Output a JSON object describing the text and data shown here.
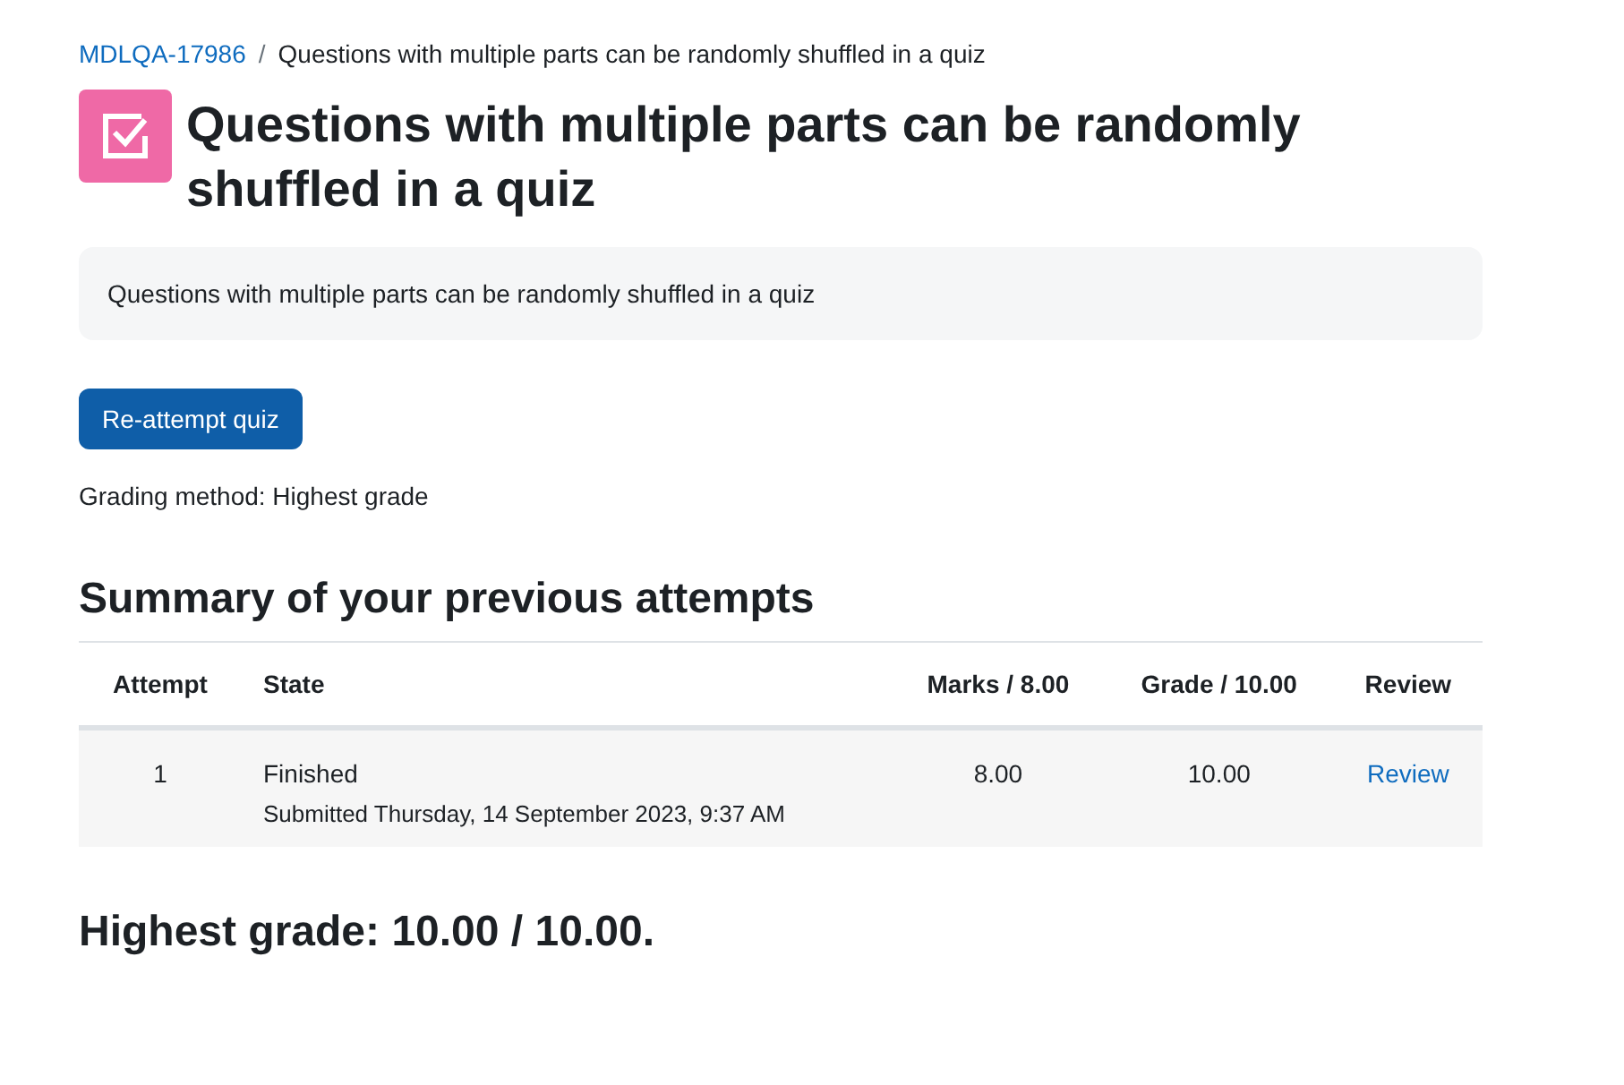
{
  "breadcrumb": [
    {
      "label": "MDLQA-17986",
      "link": true
    },
    {
      "label": "Questions with multiple parts can be randomly shuffled in a quiz",
      "link": false
    }
  ],
  "breadcrumb_separator": "/",
  "title": "Questions with multiple parts can be randomly shuffled in a quiz",
  "description": "Questions with multiple parts can be randomly shuffled in a quiz",
  "reattempt_button": "Re-attempt quiz",
  "grading_method": "Grading method: Highest grade",
  "summary_heading": "Summary of your previous attempts",
  "table": {
    "columns": [
      "Attempt",
      "State",
      "Marks / 8.00",
      "Grade / 10.00",
      "Review"
    ],
    "rows": [
      {
        "attempt": "1",
        "state": "Finished",
        "submitted": "Submitted Thursday, 14 September 2023, 9:37 AM",
        "marks": "8.00",
        "grade": "10.00",
        "review": "Review"
      }
    ]
  },
  "highest_grade": "Highest grade: 10.00 / 10.00."
}
